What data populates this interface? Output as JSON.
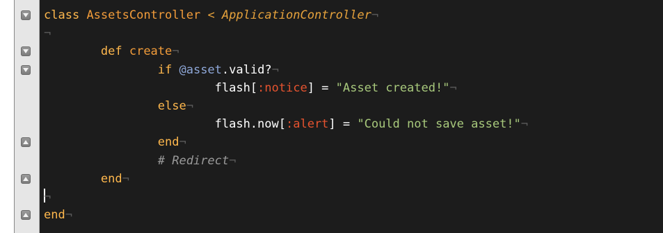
{
  "editor": {
    "lines": [
      {
        "tokens": [
          {
            "t": "class",
            "c": "kw"
          },
          {
            "t": " ",
            "c": "op"
          },
          {
            "t": "AssetsController",
            "c": "const"
          },
          {
            "t": " < ",
            "c": "superclass"
          },
          {
            "t": "ApplicationController",
            "c": "superclass"
          },
          {
            "t": "¬",
            "c": "nl"
          }
        ]
      },
      {
        "tokens": [
          {
            "t": "¬",
            "c": "nl"
          }
        ]
      },
      {
        "tokens": [
          {
            "t": "        def",
            "c": "kw"
          },
          {
            "t": " ",
            "c": "op"
          },
          {
            "t": "create",
            "c": "const"
          },
          {
            "t": "¬",
            "c": "nl"
          }
        ]
      },
      {
        "tokens": [
          {
            "t": "                if",
            "c": "kw"
          },
          {
            "t": " ",
            "c": "op"
          },
          {
            "t": "@asset",
            "c": "ivar"
          },
          {
            "t": ".valid?",
            "c": "op"
          },
          {
            "t": "¬",
            "c": "nl"
          }
        ]
      },
      {
        "tokens": [
          {
            "t": "                        flash[",
            "c": "op"
          },
          {
            "t": ":notice",
            "c": "sym"
          },
          {
            "t": "] = ",
            "c": "op"
          },
          {
            "t": "\"Asset created!\"",
            "c": "str"
          },
          {
            "t": "¬",
            "c": "nl"
          }
        ]
      },
      {
        "tokens": [
          {
            "t": "                else",
            "c": "kw"
          },
          {
            "t": "¬",
            "c": "nl"
          }
        ]
      },
      {
        "tokens": [
          {
            "t": "                        flash.now[",
            "c": "op"
          },
          {
            "t": ":alert",
            "c": "sym"
          },
          {
            "t": "] = ",
            "c": "op"
          },
          {
            "t": "\"Could not save asset!\"",
            "c": "str"
          },
          {
            "t": "¬",
            "c": "nl"
          }
        ]
      },
      {
        "tokens": [
          {
            "t": "                end",
            "c": "kw"
          },
          {
            "t": "¬",
            "c": "nl"
          }
        ]
      },
      {
        "tokens": [
          {
            "t": "                # Redirect",
            "c": "comment"
          },
          {
            "t": "¬",
            "c": "nl"
          }
        ]
      },
      {
        "tokens": [
          {
            "t": "        end",
            "c": "kw"
          },
          {
            "t": "¬",
            "c": "nl"
          }
        ]
      },
      {
        "tokens": [
          {
            "t": "¬",
            "c": "nl"
          }
        ]
      },
      {
        "tokens": [
          {
            "t": "end",
            "c": "kw"
          },
          {
            "t": "¬",
            "c": "nl"
          }
        ]
      }
    ],
    "fold_markers": [
      {
        "line": 0,
        "dir": "open"
      },
      {
        "line": 2,
        "dir": "open"
      },
      {
        "line": 3,
        "dir": "open"
      },
      {
        "line": 7,
        "dir": "close"
      },
      {
        "line": 9,
        "dir": "close"
      },
      {
        "line": 11,
        "dir": "close"
      }
    ]
  },
  "colors": {
    "background": "#1c1c1c",
    "gutter": "#e6e6e6",
    "keyword": "#ffb84d",
    "constant": "#f29c3a",
    "instance_variable": "#8ea7d8",
    "symbol": "#e5532f",
    "string": "#a8c97c",
    "comment": "#9a9a9a"
  }
}
